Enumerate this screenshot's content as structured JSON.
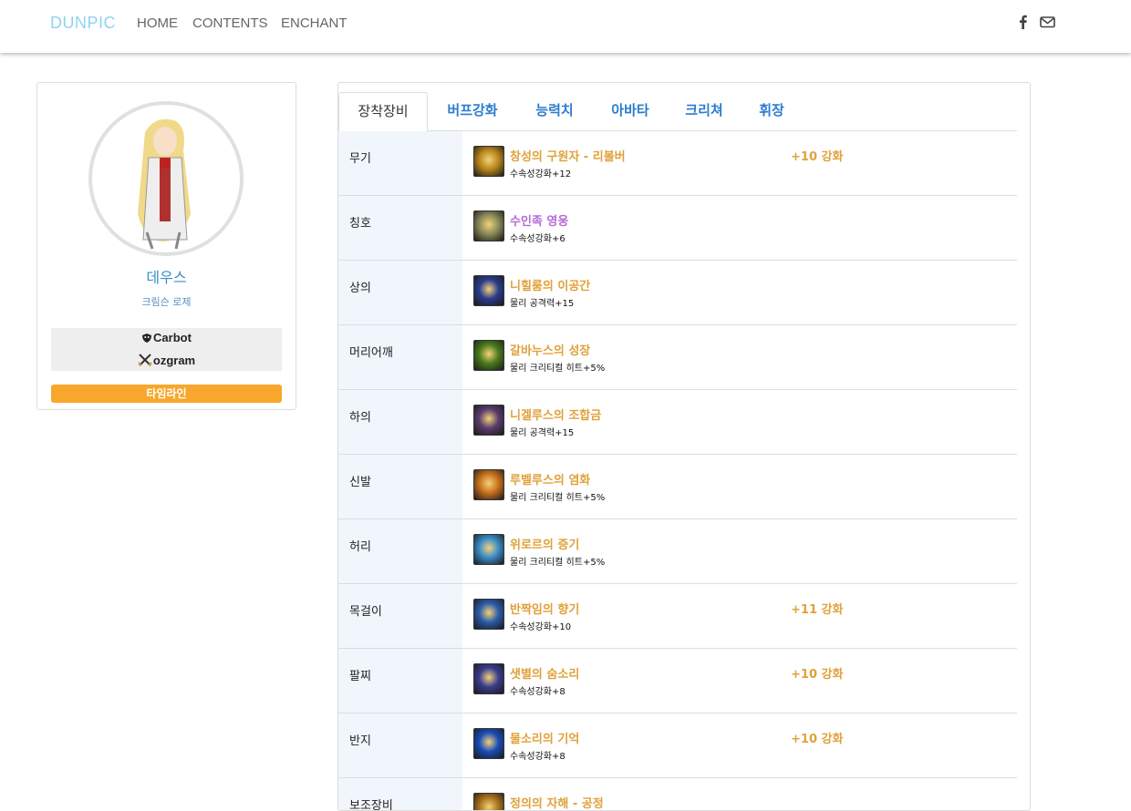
{
  "nav": {
    "brand": "DUNPIC",
    "links": [
      "HOME",
      "CONTENTS",
      "ENCHANT"
    ],
    "social": [
      "facebook-icon",
      "mail-icon"
    ]
  },
  "profile": {
    "name": "데우스",
    "server": "크림슨 로제",
    "guilds": [
      {
        "icon": "shield-icon",
        "name": "Carbot"
      },
      {
        "icon": "crossed-swords-icon",
        "name": "ozgram"
      }
    ],
    "timeline_label": "타임라인"
  },
  "tabs": [
    "장착장비",
    "버프강화",
    "능력치",
    "아바타",
    "크리쳐",
    "휘장"
  ],
  "equipment": [
    {
      "slot": "무기",
      "name": "창성의 구원자 - 리볼버",
      "sub": "수속성강화+12",
      "reinforce": "+10 강화",
      "rarity": "orange",
      "icon_color": "#b8861c"
    },
    {
      "slot": "칭호",
      "name": "수인족 영웅",
      "sub": "수속성강화+6",
      "reinforce": "",
      "rarity": "purple",
      "icon_color": "#8a8a5a"
    },
    {
      "slot": "상의",
      "name": "니힐룸의 이공간",
      "sub": "물리 공격력+15",
      "reinforce": "",
      "rarity": "orange",
      "icon_color": "#2a3c8c"
    },
    {
      "slot": "머리어깨",
      "name": "갈바누스의 성장",
      "sub": "물리 크리티컬 히트+5%",
      "reinforce": "",
      "rarity": "orange",
      "icon_color": "#4a7a1c"
    },
    {
      "slot": "하의",
      "name": "니겔루스의 조합금",
      "sub": "물리 공격력+15",
      "reinforce": "",
      "rarity": "orange",
      "icon_color": "#5a3c6c"
    },
    {
      "slot": "신발",
      "name": "루벨루스의 염화",
      "sub": "물리 크리티컬 히트+5%",
      "reinforce": "",
      "rarity": "orange",
      "icon_color": "#c8701c"
    },
    {
      "slot": "허리",
      "name": "위로르의 증기",
      "sub": "물리 크리티컬 히트+5%",
      "reinforce": "",
      "rarity": "orange",
      "icon_color": "#3a8cc8"
    },
    {
      "slot": "목걸이",
      "name": "반짝임의 향기",
      "sub": "수속성강화+10",
      "reinforce": "+11 강화",
      "rarity": "orange",
      "icon_color": "#2a5ca8"
    },
    {
      "slot": "팔찌",
      "name": "샛별의 숨소리",
      "sub": "수속성강화+8",
      "reinforce": "+10 강화",
      "rarity": "orange",
      "icon_color": "#3a3c8c"
    },
    {
      "slot": "반지",
      "name": "물소리의 기억",
      "sub": "수속성강화+8",
      "reinforce": "+10 강화",
      "rarity": "orange",
      "icon_color": "#1a4cb8"
    },
    {
      "slot": "보조장비",
      "name": "정의의 자해 - 공정",
      "sub": "",
      "reinforce": "",
      "rarity": "orange",
      "icon_color": "#a8701c"
    }
  ]
}
